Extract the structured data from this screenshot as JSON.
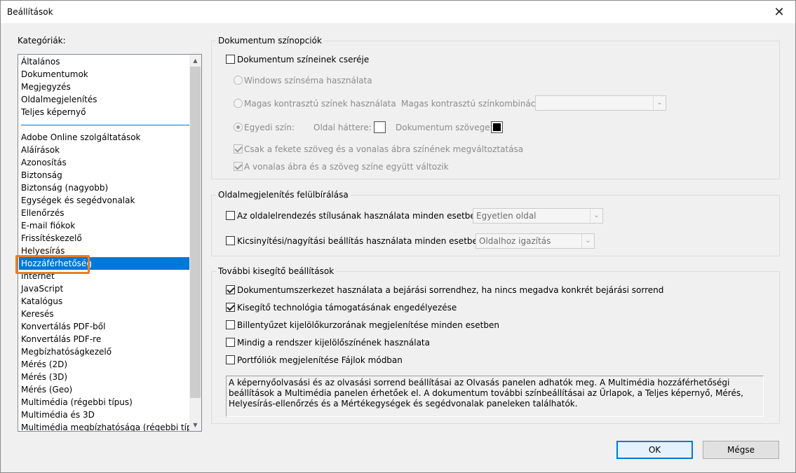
{
  "window": {
    "title": "Beállítások",
    "close_glyph": "✕"
  },
  "categories": {
    "label": "Kategóriák:",
    "top_items": [
      "Általános",
      "Dokumentumok",
      "Megjegyzés",
      "Oldalmegjelenítés",
      "Teljes képernyő"
    ],
    "items": [
      "Adobe Online szolgáltatások",
      "Aláírások",
      "Azonosítás",
      "Biztonság",
      "Biztonság (nagyobb)",
      "Egységek és segédvonalak",
      "Ellenőrzés",
      "E-mail fiókok",
      "Frissítéskezelő",
      "Helyesírás",
      "Hozzáférhetőség",
      "Internet",
      "JavaScript",
      "Katalógus",
      "Keresés",
      "Konvertálás PDF-ből",
      "Konvertálás PDF-re",
      "Megbízhatóságkezelő",
      "Mérés (2D)",
      "Mérés (3D)",
      "Mérés (Geo)",
      "Multimédia (régebbi típus)",
      "Multimédia és 3D",
      "Multimédia megbízhatósága (régebbi típus)"
    ],
    "selected": "Hozzáférhetőség",
    "accent_color": "#0078d7",
    "highlight_color": "#e97e24"
  },
  "doc_colors": {
    "title": "Dokumentum színopciók",
    "replace_colors": {
      "label": "Dokumentum színeinek cseréje",
      "checked": false
    },
    "windows_theme": "Windows színséma használata",
    "high_contrast": "Magas kontrasztú színek használata",
    "high_contrast_combo_label": "Magas kontrasztú színkombináció:",
    "high_contrast_combo_value": "",
    "custom_color": "Egyedi szín:",
    "page_background_label": "Oldal háttere:",
    "page_background_color": "#ffffff",
    "doc_text_label": "Dokumentum szövege:",
    "doc_text_color": "#000000",
    "only_black_text": "Csak a fekete szöveg és a vonalas ábra színének megváltoztatása",
    "line_art_together": "A vonalas ábra és a szöveg színe együtt változik"
  },
  "page_display": {
    "title": "Oldalmegjelenítés felülbírálása",
    "layout_label": "Az oldalelrendezés stílusának használata minden esetben",
    "layout_value": "Egyetlen oldal",
    "zoom_label": "Kicsinyítési/nagyítási beállítás használata minden esetben",
    "zoom_value": "Oldalhoz igazítás"
  },
  "other": {
    "title": "További kisegítő beállítások",
    "options": [
      {
        "label": "Dokumentumszerkezet használata a bejárási sorrendhez, ha nincs megadva konkrét bejárási sorrend",
        "checked": true
      },
      {
        "label": "Kisegítő technológia támogatásának engedélyezése",
        "checked": true
      },
      {
        "label": "Billentyűzet kijelölőkurzorának megjelenítése minden esetben",
        "checked": false
      },
      {
        "label": "Mindig a rendszer kijelölőszínének használata",
        "checked": false
      },
      {
        "label": "Portfóliók megjelenítése Fájlok módban",
        "checked": false
      }
    ],
    "info_text": "A képernyőolvasási és az olvasási sorrend beállításai az Olvasás panelen adhatók meg. A Multimédia hozzáférhetőségi beállítások a Multimédia panelen érhetőek el. A dokumentum további színbeállításai az Űrlapok, a Teljes képernyő, Mérés, Helyesírás-ellenőrzés és a Mértékegységek és segédvonalak paneleken találhatók."
  },
  "buttons": {
    "ok": "OK",
    "cancel": "Mégse"
  },
  "icons": {
    "scroll_up": "▲",
    "scroll_down": "▼",
    "combo_arrow": "⌄"
  }
}
